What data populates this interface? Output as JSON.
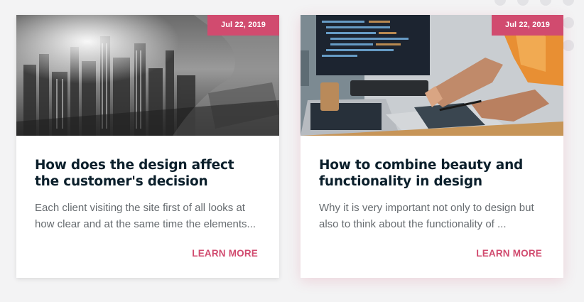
{
  "posts": [
    {
      "date": "Jul 22, 2019",
      "title": "How does the design affect the customer's decision",
      "excerpt": "Each client visiting the site first of all looks at how clear and at the same time the elements...",
      "link_label": "LEARN MORE",
      "image_alt": "Grayscale city skyline blended with a person at a laptop"
    },
    {
      "date": "Jul 22, 2019",
      "title": "How to combine beauty and functionality in design",
      "excerpt": "Why it is very important not only to design but also to think about the functionality of ...",
      "link_label": "LEARN MORE",
      "image_alt": "Developers pointing at code on laptop and monitor screens"
    }
  ],
  "colors": {
    "accent": "#d14b6f",
    "title": "#0b1f2b",
    "text": "#666b6f",
    "background": "#f3f3f4"
  }
}
